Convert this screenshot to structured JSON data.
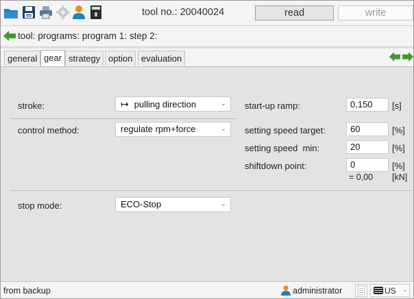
{
  "toolbar": {
    "tool_no": "tool no.: 20040024",
    "read_label": "read",
    "write_label": "write",
    "icons": [
      "open-folder-icon",
      "save-icon",
      "print-icon",
      "settings-gear-icon",
      "user-icon",
      "device-icon"
    ]
  },
  "breadcrumb": {
    "text": "tool: programs: program 1: step 2:"
  },
  "tabs": [
    "general",
    "gear",
    "strategy",
    "option",
    "evaluation"
  ],
  "active_tab": "gear",
  "form": {
    "stroke": {
      "label": "stroke:",
      "value": "pulling direction",
      "arrow": "↦"
    },
    "control_method": {
      "label": "control method:",
      "value": "regulate rpm+force"
    },
    "stop_mode": {
      "label": "stop mode:",
      "value": "ECO-Stop"
    },
    "startup_ramp": {
      "label": "start-up ramp:",
      "value": "0,150",
      "unit": "[s]"
    },
    "setting_speed_target": {
      "label": "setting speed",
      "sub": "target:",
      "value": "60",
      "unit": "[%]"
    },
    "setting_speed_min": {
      "label": "setting speed",
      "sub": "min:",
      "value": "20",
      "unit": "[%]"
    },
    "shiftdown_point": {
      "label": "shiftdown point:",
      "value": "0",
      "unit": "[%]",
      "derived": "= 0,00",
      "derived_unit": "[kN]"
    }
  },
  "status": {
    "left_text": "from backup",
    "user": "administrator",
    "language": "US"
  },
  "colors": {
    "accent_green": "#3f9b2a",
    "background": "#e3e3e3",
    "bar": "#f4f4f4",
    "folder_blue": "#1e7fc8",
    "user_orange": "#e98a1c"
  }
}
